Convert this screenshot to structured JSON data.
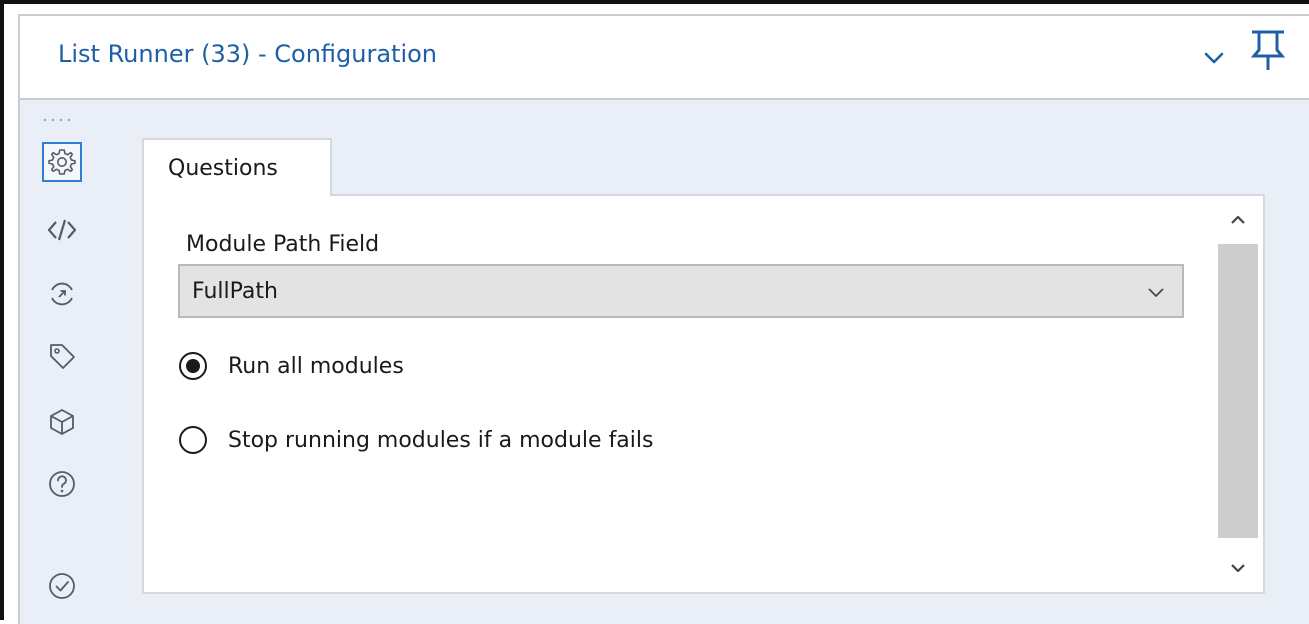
{
  "window": {
    "title": "List Runner (33) - Configuration"
  },
  "title_bar_icons": [
    "chevron-down-icon",
    "pin-icon"
  ],
  "sidebar": {
    "icons": [
      {
        "name": "gear-icon",
        "selected": true
      },
      {
        "name": "code-icon",
        "selected": false
      },
      {
        "name": "connection-progress-icon",
        "selected": false
      },
      {
        "name": "tag-icon",
        "selected": false
      },
      {
        "name": "package-icon",
        "selected": false
      },
      {
        "name": "help-icon",
        "selected": false
      },
      {
        "name": "check-circle-icon",
        "selected": false
      }
    ]
  },
  "tabs": [
    {
      "label": "Questions",
      "active": true
    }
  ],
  "form": {
    "module_path_label": "Module Path Field",
    "module_path_value": "FullPath",
    "radio_options": [
      {
        "label": "Run all modules",
        "checked": true
      },
      {
        "label": "Stop running modules if a module fails",
        "checked": false
      }
    ]
  },
  "colors": {
    "title_text": "#1f5fa8",
    "selected_border": "#2f7fd1",
    "body_background": "#e9eef7"
  }
}
